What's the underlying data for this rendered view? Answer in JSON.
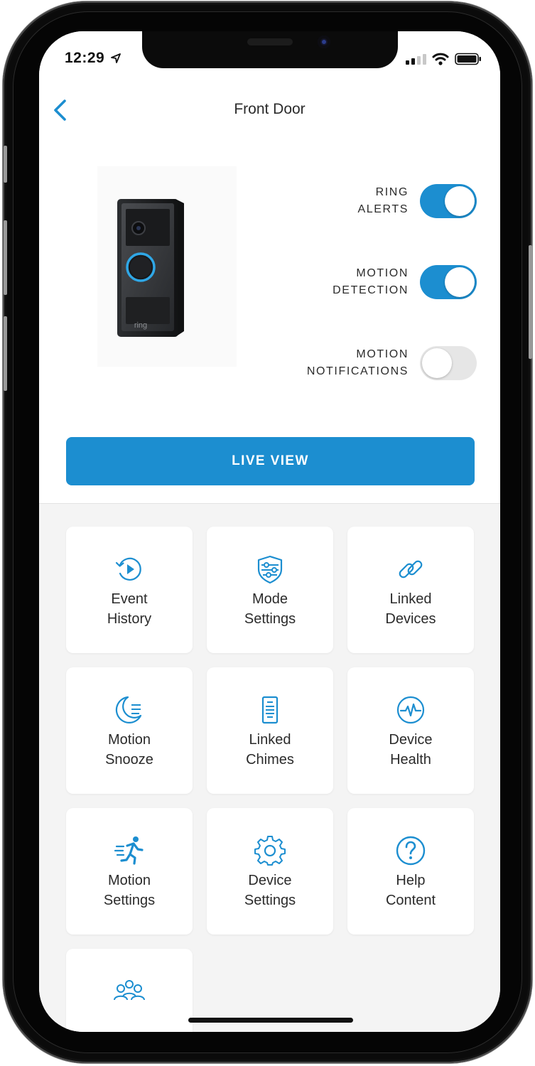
{
  "status_bar": {
    "time": "12:29"
  },
  "header": {
    "title": "Front Door"
  },
  "toggles": [
    {
      "line1": "RING",
      "line2": "ALERTS",
      "on": true
    },
    {
      "line1": "MOTION",
      "line2": "DETECTION",
      "on": true
    },
    {
      "line1": "MOTION",
      "line2": "NOTIFICATIONS",
      "on": false
    }
  ],
  "device": {
    "brand_mark": "ring"
  },
  "live_view": {
    "label": "LIVE VIEW"
  },
  "tiles": [
    {
      "line1": "Event",
      "line2": "History",
      "icon": "event-history-icon"
    },
    {
      "line1": "Mode",
      "line2": "Settings",
      "icon": "mode-settings-icon"
    },
    {
      "line1": "Linked",
      "line2": "Devices",
      "icon": "link-icon"
    },
    {
      "line1": "Motion",
      "line2": "Snooze",
      "icon": "moon-snooze-icon"
    },
    {
      "line1": "Linked",
      "line2": "Chimes",
      "icon": "chime-icon"
    },
    {
      "line1": "Device",
      "line2": "Health",
      "icon": "pulse-icon"
    },
    {
      "line1": "Motion",
      "line2": "Settings",
      "icon": "running-person-icon"
    },
    {
      "line1": "Device",
      "line2": "Settings",
      "icon": "gear-icon"
    },
    {
      "line1": "Help",
      "line2": "Content",
      "icon": "question-icon"
    },
    {
      "line1": "",
      "line2": "",
      "icon": "shared-users-icon"
    }
  ],
  "colors": {
    "accent": "#1c8ed0",
    "toggle_off": "#e6e6e6",
    "text": "#2b2b2b",
    "background": "#f4f4f4"
  }
}
